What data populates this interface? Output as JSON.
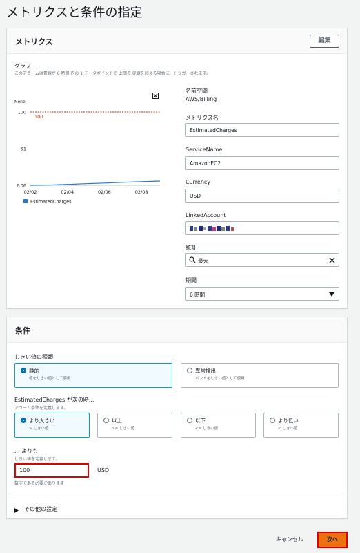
{
  "page": {
    "title": "メトリクスと条件の指定"
  },
  "metrics": {
    "title": "メトリクス",
    "edit_label": "編集",
    "graph_label": "グラフ",
    "graph_desc": "このアラームは青線が 6 時間 内の 1 データポイントで 上回る 赤線を超える場合に、トリガーされます。",
    "chart_none": "None",
    "namespace_label": "名前空間",
    "namespace_value": "AWS/Billing",
    "metric_name_label": "メトリクス名",
    "metric_name_value": "EstimatedCharges",
    "service_label": "ServiceName",
    "service_value": "AmazonEC2",
    "currency_label": "Currency",
    "currency_value": "USD",
    "linked_label": "LinkedAccount",
    "linked_value": "",
    "stat_label": "統計",
    "stat_value": "最大",
    "period_label": "期間",
    "period_value": "6 時間"
  },
  "chart_data": {
    "type": "line",
    "x": [
      "02/02",
      "02/03",
      "02/04",
      "02/05",
      "02/06",
      "02/07",
      "02/08",
      "02/09"
    ],
    "x_ticks": [
      "02/02",
      "02/04",
      "02/06",
      "02/08"
    ],
    "y_ticks": [
      "100",
      "51",
      "2.06"
    ],
    "ylim": [
      2.06,
      100
    ],
    "threshold": 100,
    "threshold_label": "100",
    "series": [
      {
        "name": "EstimatedCharges",
        "values": [
          2.06,
          2.4,
          3.2,
          4.2,
          5.0,
          6.0,
          6.8,
          7.6
        ],
        "color": "#2f78c4"
      }
    ],
    "threshold_color": "#d13212"
  },
  "conditions": {
    "title": "条件",
    "threshold_type_label": "しきい値の種類",
    "static_title": "静的",
    "static_desc": "値をしきい値として使用",
    "anomaly_title": "異常検出",
    "anomaly_desc": "バンドをしきい値として使用",
    "when_label": "EstimatedCharges が次の時...",
    "when_desc": "アラーム条件を定義します。",
    "options": [
      {
        "title": "より大きい",
        "desc": "> しきい値"
      },
      {
        "title": "以上",
        "desc": ">= しきい値"
      },
      {
        "title": "以下",
        "desc": "<= しきい値"
      },
      {
        "title": "より低い",
        "desc": "< しきい値"
      }
    ],
    "than_label": "... よりも",
    "than_desc": "しきい値を定義します。",
    "threshold_value": "100",
    "unit": "USD",
    "number_hint": "数字である必要があります",
    "additional": "その他の設定"
  },
  "footer": {
    "cancel": "キャンセル",
    "next": "次へ"
  }
}
